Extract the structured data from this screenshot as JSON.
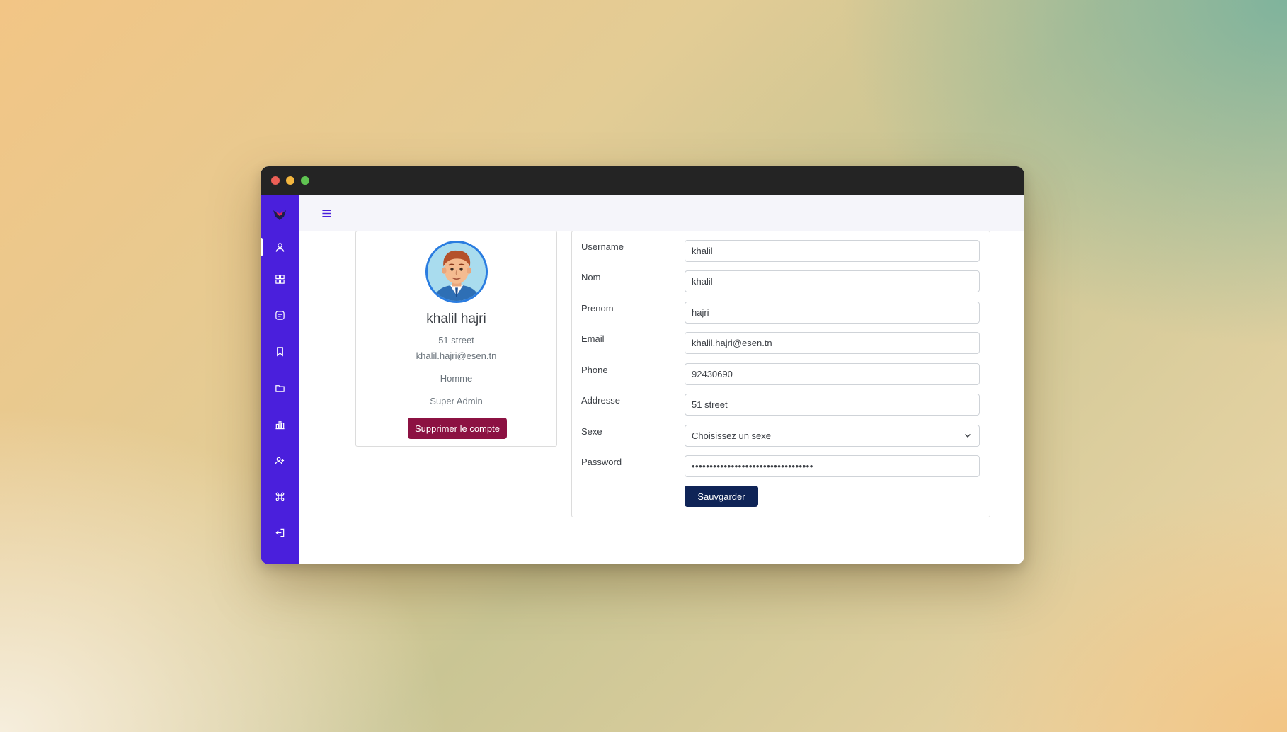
{
  "sidebar": {
    "logo": "app-logo",
    "items": [
      {
        "icon": "user-icon",
        "name": "sidebar-item-profile",
        "active": true
      },
      {
        "icon": "grid-icon",
        "name": "sidebar-item-dashboard"
      },
      {
        "icon": "message-icon",
        "name": "sidebar-item-messages"
      },
      {
        "icon": "bookmark-icon",
        "name": "sidebar-item-bookmarks"
      },
      {
        "icon": "folder-icon",
        "name": "sidebar-item-folders"
      },
      {
        "icon": "bar-chart-icon",
        "name": "sidebar-item-statistics"
      },
      {
        "icon": "user-add-icon",
        "name": "sidebar-item-add-user"
      },
      {
        "icon": "command-icon",
        "name": "sidebar-item-command"
      },
      {
        "icon": "logout-icon",
        "name": "sidebar-item-logout"
      }
    ]
  },
  "topbar": {
    "menu_icon": "hamburger-menu-icon"
  },
  "profile": {
    "full_name": "khalil hajri",
    "address": "51 street",
    "email": "khalil.hajri@esen.tn",
    "gender": "Homme",
    "role": "Super Admin",
    "delete_label": "Supprimer le compte"
  },
  "form": {
    "username_label": "Username",
    "username_value": "khalil",
    "nom_label": "Nom",
    "nom_value": "khalil",
    "prenom_label": "Prenom",
    "prenom_value": "hajri",
    "email_label": "Email",
    "email_value": "khalil.hajri@esen.tn",
    "phone_label": "Phone",
    "phone_value": "92430690",
    "addresse_label": "Addresse",
    "addresse_value": "51 street",
    "sexe_label": "Sexe",
    "sexe_value": "Choisissez un sexe",
    "password_label": "Password",
    "password_value": "••••••••••••••••••••••••••••••••••",
    "save_label": "Sauvgarder"
  },
  "colors": {
    "sidebar": "#4a1fdc",
    "delete_button": "#8c1142",
    "save_button": "#0f2457",
    "avatar_border": "#2a7ce0"
  }
}
